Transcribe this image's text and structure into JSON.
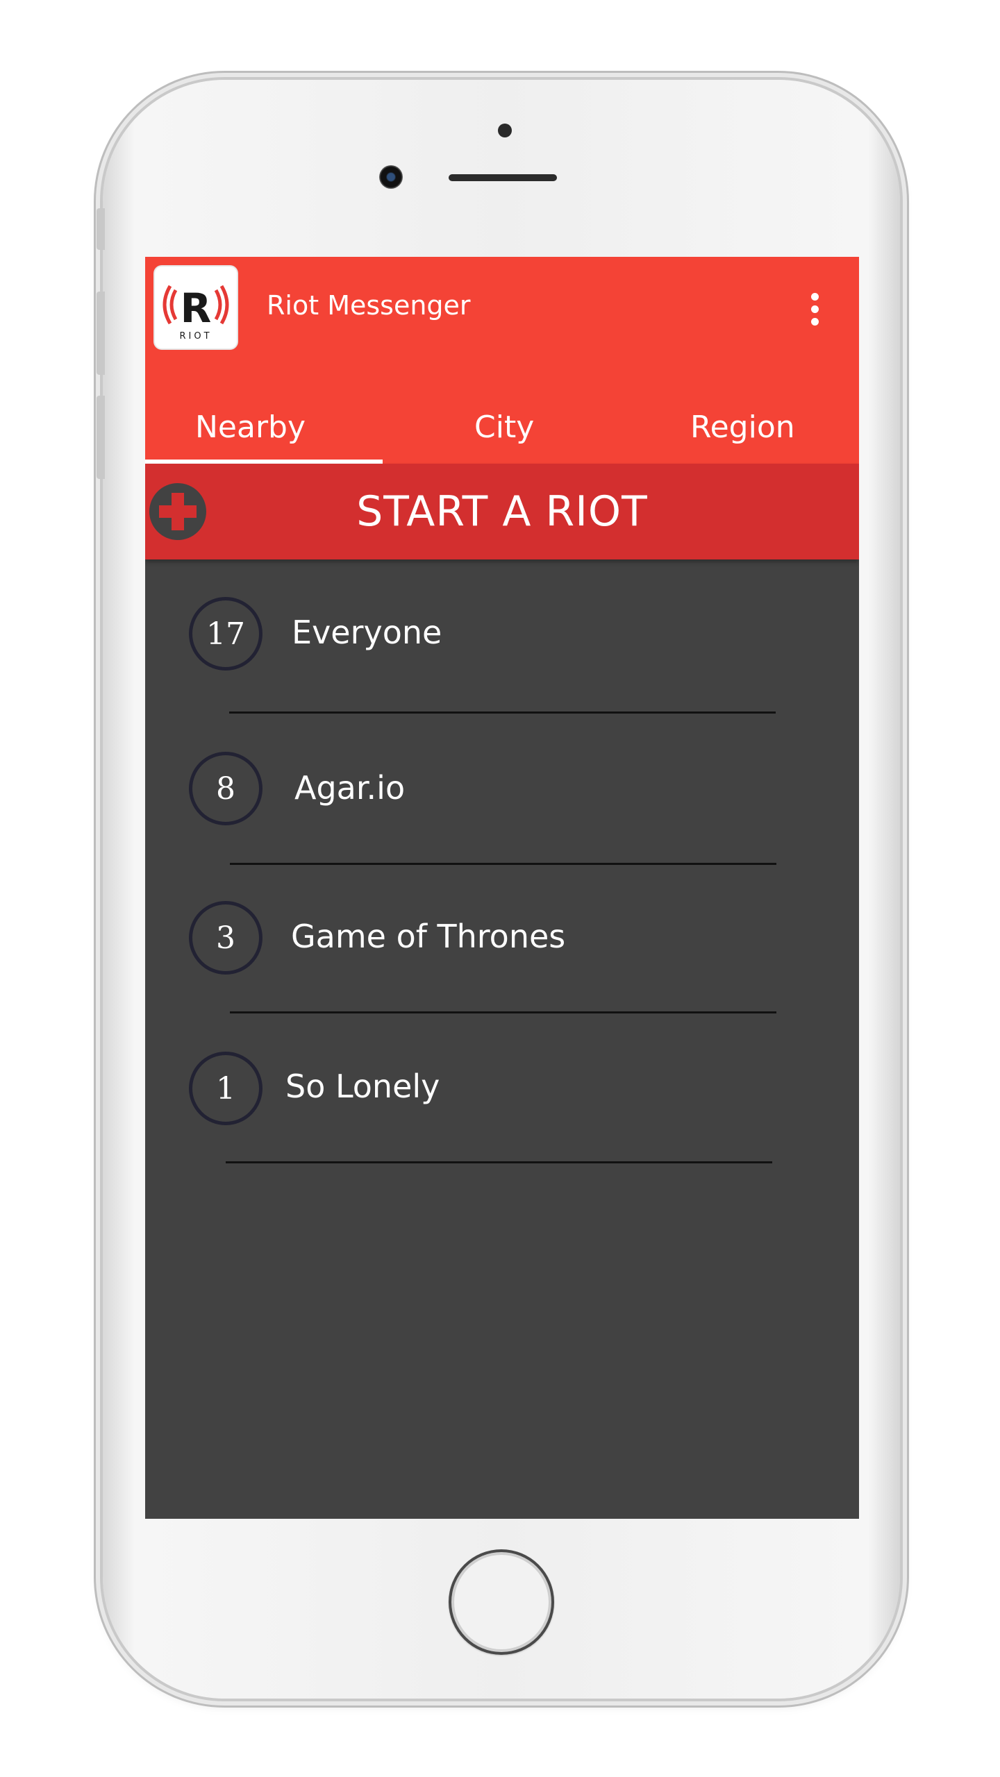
{
  "app": {
    "title": "Riot Messenger",
    "logo_text": "RIOT"
  },
  "tabs": [
    {
      "label": "Nearby",
      "selected": true
    },
    {
      "label": "City",
      "selected": false
    },
    {
      "label": "Region",
      "selected": false
    }
  ],
  "start_riot": {
    "label": "START A RIOT"
  },
  "riots": [
    {
      "count": "17",
      "name": "Everyone"
    },
    {
      "count": "8",
      "name": "Agar.io"
    },
    {
      "count": "3",
      "name": "Game of Thrones"
    },
    {
      "count": "1",
      "name": "So Lonely"
    }
  ],
  "colors": {
    "primary": "#f44336",
    "primary_dark": "#d32f2f",
    "background": "#424242"
  }
}
